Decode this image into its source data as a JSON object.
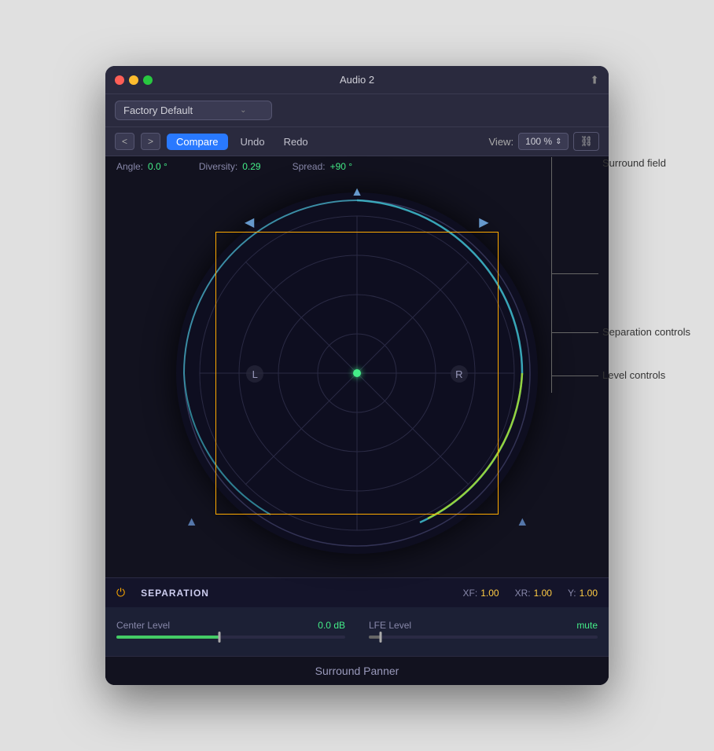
{
  "window": {
    "title": "Audio 2",
    "traffic_lights": [
      "close",
      "minimize",
      "maximize"
    ]
  },
  "preset": {
    "label": "Factory Default",
    "chevron": "⌄"
  },
  "toolbar": {
    "nav_back": "<",
    "nav_forward": ">",
    "compare": "Compare",
    "undo": "Undo",
    "redo": "Redo",
    "view_label": "View:",
    "view_pct": "100 %",
    "link_icon": "🔗"
  },
  "params": {
    "angle_label": "Angle:",
    "angle_value": "0.0 °",
    "diversity_label": "Diversity:",
    "diversity_value": "0.29",
    "spread_label": "Spread:",
    "spread_value": "+90 °"
  },
  "surround_field": {
    "label": "Surround field",
    "channels": [
      "L",
      "R"
    ],
    "center_dot_color": "#44ee88"
  },
  "separation": {
    "power_icon": "⏻",
    "title": "SEPARATION",
    "xf_label": "XF:",
    "xf_value": "1.00",
    "xr_label": "XR:",
    "xr_value": "1.00",
    "y_label": "Y:",
    "y_value": "1.00",
    "annotation": "Separation controls"
  },
  "levels": {
    "center_level_label": "Center Level",
    "center_level_value": "0.0 dB",
    "center_slider_pct": 45,
    "lfe_level_label": "LFE Level",
    "lfe_level_value": "mute",
    "lfe_slider_pct": 5,
    "annotation": "Level controls"
  },
  "footer": {
    "label": "Surround Panner"
  }
}
